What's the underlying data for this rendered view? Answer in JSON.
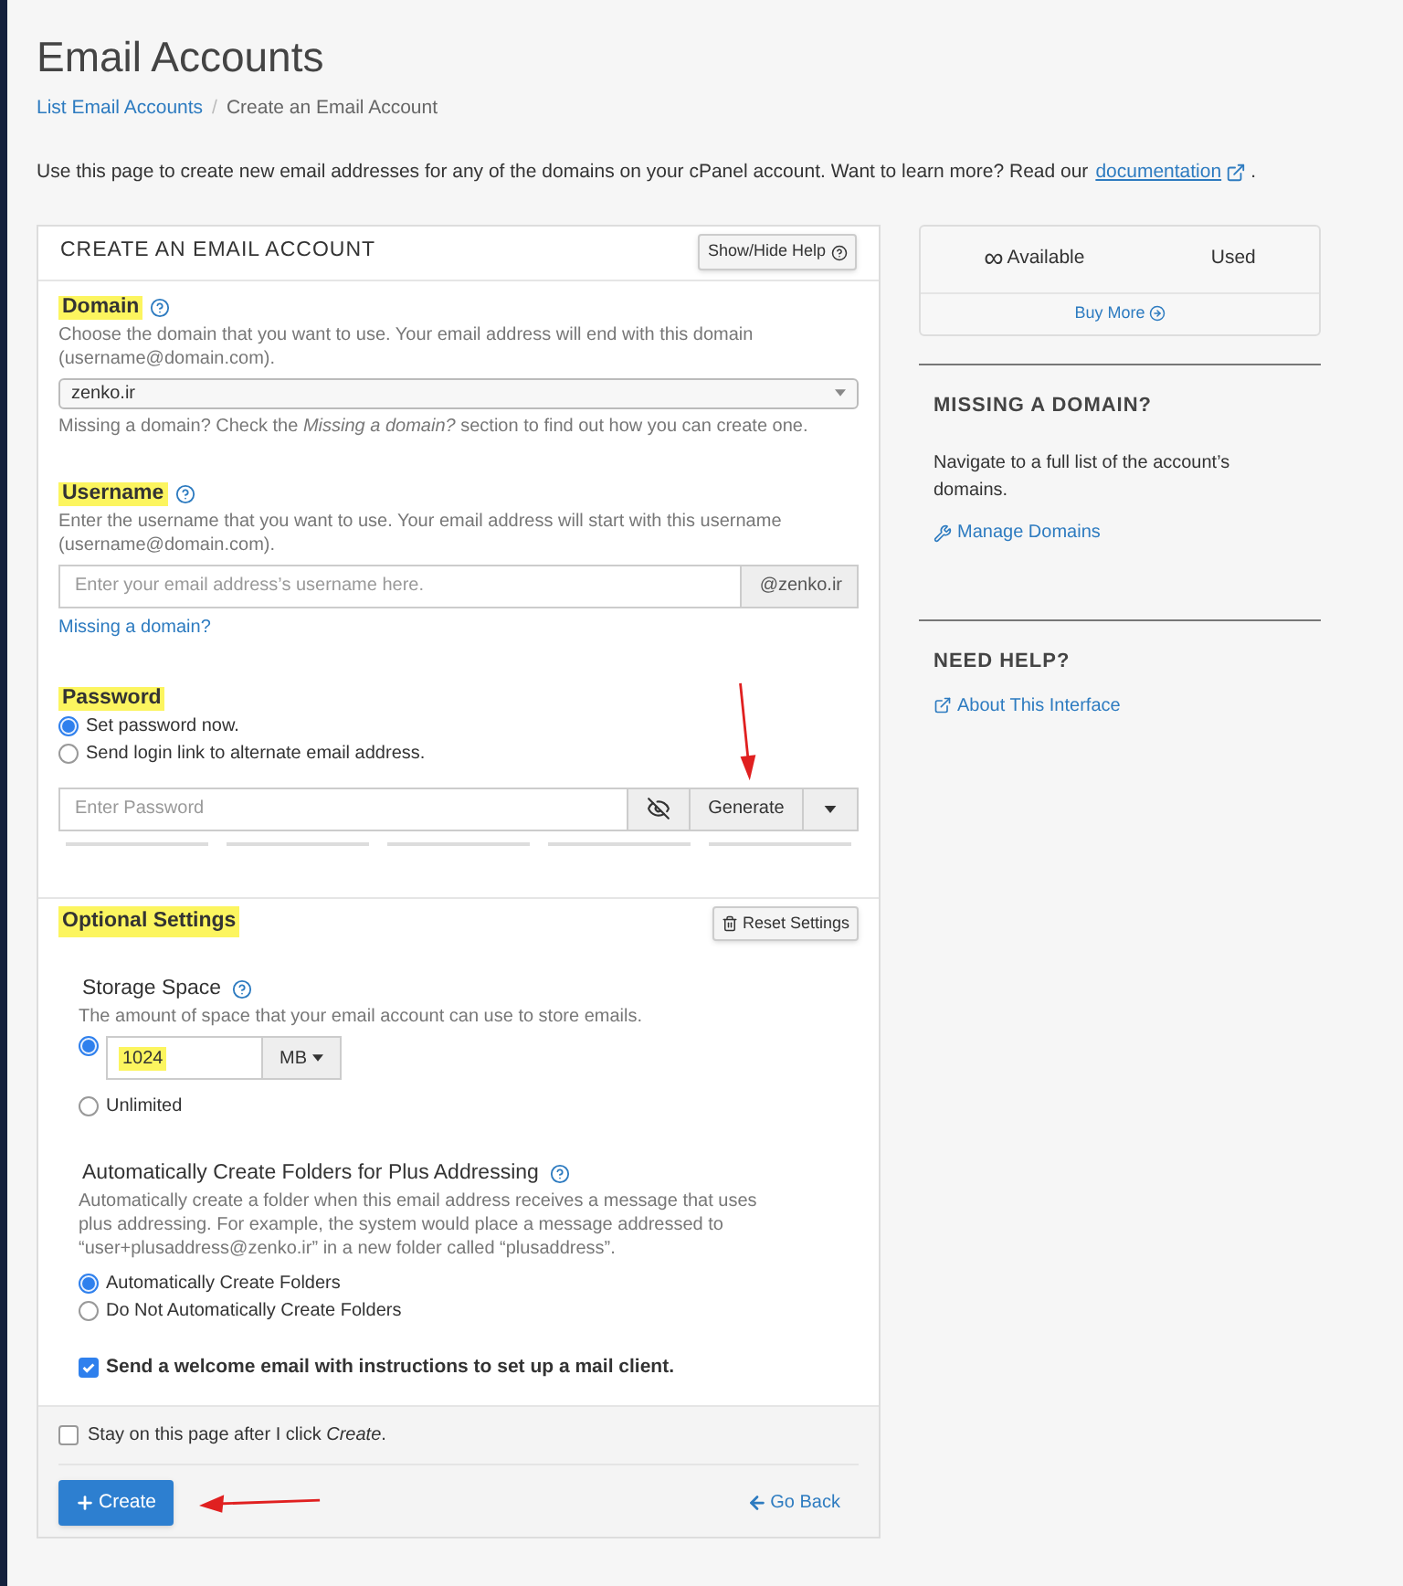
{
  "page": {
    "title": "Email Accounts",
    "breadcrumb": [
      {
        "label": "List Email Accounts",
        "link": true
      },
      {
        "label": "Create an Email Account",
        "link": false
      }
    ],
    "breadcrumb_separator": "/",
    "intro": "Use this page to create new email addresses for any of the domains on your cPanel account. Want to learn more? Read our",
    "intro_link": "documentation",
    "intro_end": "."
  },
  "form": {
    "title": "CREATE AN EMAIL ACCOUNT",
    "help_button": "Show/Hide Help",
    "domain": {
      "label": "Domain",
      "highlighted": true,
      "help": "Choose the domain that you want to use. Your email address will end with this domain (username@domain.com).",
      "value": "zenko.ir",
      "note": "Missing a domain? Check the *Missing a domain?* section to find out how you can create one."
    },
    "username": {
      "label": "Username",
      "highlighted": true,
      "help": "Enter the username that you want to use. Your email address will start with this username (username@domain.com).",
      "placeholder": "Enter your email address’s username here.",
      "suffix": "@zenko.ir",
      "link": "Missing a domain?"
    },
    "password": {
      "label": "Password",
      "highlighted": true,
      "options": [
        {
          "label": "Set password now.",
          "selected": true
        },
        {
          "label": "Send login link to alternate email address.",
          "selected": false
        }
      ],
      "placeholder": "Enter Password",
      "generate": "Generate"
    },
    "optional": {
      "label": "Optional Settings",
      "highlighted": true,
      "reset_button": "Reset Settings",
      "storage": {
        "label": "Storage Space",
        "help": "The amount of space that your email account can use to store emails.",
        "options": [
          {
            "kind": "quota",
            "selected": true,
            "value": "1024",
            "value_highlighted": true,
            "unit": "MB"
          },
          {
            "kind": "text",
            "selected": false,
            "label": "Unlimited"
          }
        ]
      },
      "folders": {
        "label": "Automatically Create Folders for Plus Addressing",
        "help": "Automatically create a folder when this email address receives a message that uses plus addressing. For example, the system would place a message addressed to “user+plusaddress@zenko.ir” in a new folder called “plusaddress”.",
        "options": [
          {
            "label": "Automatically Create Folders",
            "selected": true
          },
          {
            "label": "Do Not Automatically Create Folders",
            "selected": false
          }
        ]
      },
      "welcome": {
        "label": "Send a welcome email with instructions to set up a mail client.",
        "checked": true
      }
    },
    "footer": {
      "stay": {
        "label": "Stay on this page after I click *Create*.",
        "checked": false
      },
      "create_button": "Create",
      "back_link": "Go Back"
    }
  },
  "sidebar": {
    "stats": {
      "available_icon": "∞",
      "available": "Available",
      "used": "Used",
      "buy_more": "Buy More"
    },
    "sections": [
      {
        "title": "MISSING A DOMAIN?",
        "text": "Navigate to a full list of the account’s domains.",
        "link": "Manage Domains"
      },
      {
        "title": "NEED HELP?",
        "link": "About This Interface"
      }
    ]
  },
  "annotations": [
    {
      "kind": "arrow_down"
    },
    {
      "kind": "arrow_left"
    }
  ]
}
